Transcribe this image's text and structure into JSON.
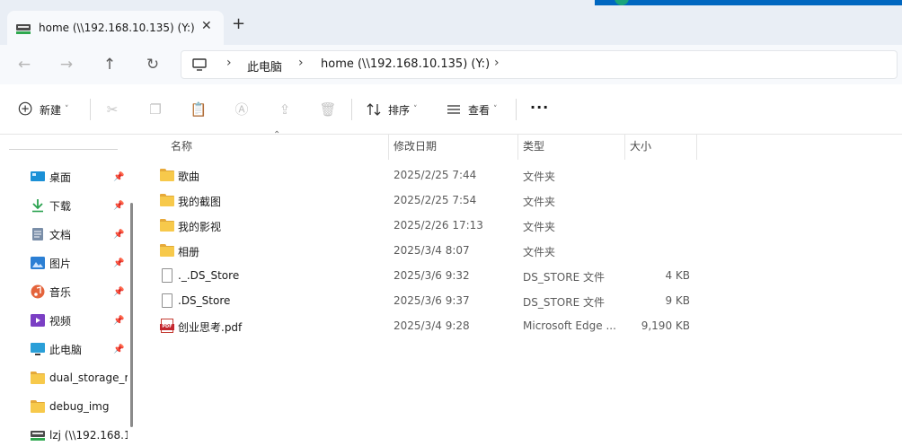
{
  "window": {
    "tab_title": "home (\\\\192.168.10.135) (Y:)",
    "close_glyph": "✕",
    "new_tab_glyph": "+"
  },
  "nav": {
    "back_glyph": "←",
    "forward_glyph": "→",
    "up_glyph": "↑",
    "refresh_glyph": "↻",
    "breadcrumbs": [
      "此电脑",
      "home (\\\\192.168.10.135) (Y:)"
    ],
    "chevron": "›"
  },
  "toolbar": {
    "new_label": "新建",
    "sort_label": "排序",
    "view_label": "查看",
    "more_label": "···",
    "caret": "˅"
  },
  "sidebar": {
    "items": [
      {
        "label": "桌面",
        "icon": "desktop-icon",
        "pinned": true
      },
      {
        "label": "下载",
        "icon": "download-icon",
        "pinned": true
      },
      {
        "label": "文档",
        "icon": "document-icon",
        "pinned": true
      },
      {
        "label": "图片",
        "icon": "pictures-icon",
        "pinned": true
      },
      {
        "label": "音乐",
        "icon": "music-icon",
        "pinned": true
      },
      {
        "label": "视频",
        "icon": "video-icon",
        "pinned": true
      },
      {
        "label": "此电脑",
        "icon": "this-pc-icon",
        "pinned": true
      },
      {
        "label": "dual_storage_r",
        "icon": "folder-icon",
        "pinned": false
      },
      {
        "label": "debug_img",
        "icon": "folder-icon",
        "pinned": false
      },
      {
        "label": "lzj (\\\\192.168.1",
        "icon": "network-drive-icon",
        "pinned": false
      }
    ],
    "pin_glyph": "📌"
  },
  "columns": {
    "name": "名称",
    "modified": "修改日期",
    "type": "类型",
    "size": "大小"
  },
  "files": [
    {
      "name": "歌曲",
      "modified": "2025/2/25 7:44",
      "type": "文件夹",
      "size": "",
      "kind": "folder"
    },
    {
      "name": "我的截图",
      "modified": "2025/2/25 7:54",
      "type": "文件夹",
      "size": "",
      "kind": "folder"
    },
    {
      "name": "我的影视",
      "modified": "2025/2/26 17:13",
      "type": "文件夹",
      "size": "",
      "kind": "folder"
    },
    {
      "name": "相册",
      "modified": "2025/3/4 8:07",
      "type": "文件夹",
      "size": "",
      "kind": "folder"
    },
    {
      "name": "._.DS_Store",
      "modified": "2025/3/6 9:32",
      "type": "DS_STORE 文件",
      "size": "4 KB",
      "kind": "file"
    },
    {
      "name": ".DS_Store",
      "modified": "2025/3/6 9:37",
      "type": "DS_STORE 文件",
      "size": "9 KB",
      "kind": "file"
    },
    {
      "name": "创业思考.pdf",
      "modified": "2025/3/4 9:28",
      "type": "Microsoft Edge ...",
      "size": "9,190 KB",
      "kind": "pdf"
    }
  ],
  "colors": {
    "accent": "#0067c0",
    "folder": "#f7c94b",
    "pdf": "#c4262e"
  }
}
